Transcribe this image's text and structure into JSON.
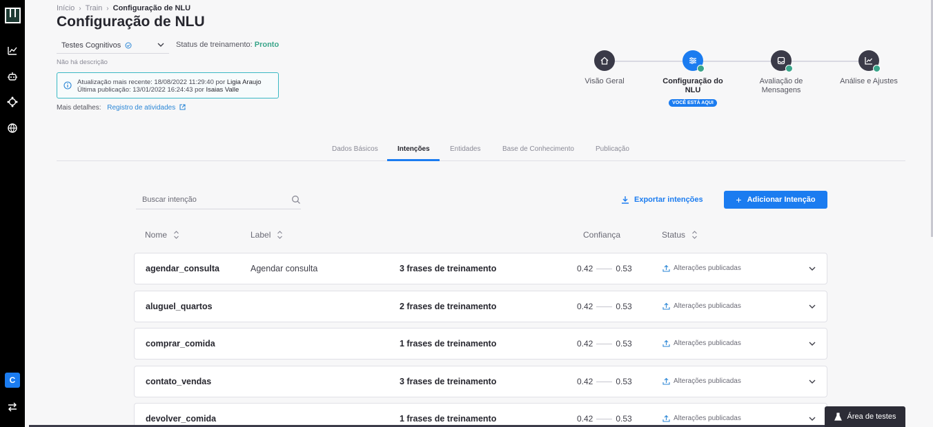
{
  "breadcrumb": {
    "home": "Início",
    "train": "Train",
    "current": "Configuração de NLU"
  },
  "page": {
    "title": "Configuração de NLU"
  },
  "bot_selector": {
    "value": "Testes Cognitivos"
  },
  "training_status": {
    "label": "Status de treinamento:",
    "value": "Pronto"
  },
  "description": "Não há descrição",
  "info": {
    "update_text": "Atualização mais recente: 18/08/2022 11:29:40 por ",
    "update_user": "Ligia Araujo",
    "publish_text": "Última publicação: 13/01/2022 16:24:43 por ",
    "publish_user": "Isaias Valle"
  },
  "more_details": {
    "label": "Mais detalhes:",
    "link": "Registro de atividades"
  },
  "stepper": {
    "steps": [
      {
        "label": "Visão Geral",
        "icon": "home-icon"
      },
      {
        "label": "Configuração do NLU",
        "icon": "sliders-icon",
        "badge": "VOCÊ ESTÁ AQUI"
      },
      {
        "label": "Avaliação de Mensagens",
        "icon": "inbox-icon"
      },
      {
        "label": "Análise e Ajustes",
        "icon": "chart-icon"
      }
    ]
  },
  "tabs": [
    "Dados Básicos",
    "Intenções",
    "Entidades",
    "Base de Conhecimento",
    "Publicação"
  ],
  "toolbar": {
    "search_placeholder": "Buscar intenção",
    "export_label": "Exportar intenções",
    "add_label": "Adicionar Intenção"
  },
  "table": {
    "headers": {
      "name": "Nome",
      "label": "Label",
      "confidence": "Confiança",
      "status": "Status"
    },
    "rows": [
      {
        "name": "agendar_consulta",
        "label": "Agendar consulta",
        "phrases": "3 frases de treinamento",
        "conf_min": "0.42",
        "conf_max": "0.53",
        "status": "Alterações publicadas"
      },
      {
        "name": "aluguel_quartos",
        "label": "",
        "phrases": "2 frases de treinamento",
        "conf_min": "0.42",
        "conf_max": "0.53",
        "status": "Alterações publicadas"
      },
      {
        "name": "comprar_comida",
        "label": "",
        "phrases": "1 frases de treinamento",
        "conf_min": "0.42",
        "conf_max": "0.53",
        "status": "Alterações publicadas"
      },
      {
        "name": "contato_vendas",
        "label": "",
        "phrases": "3 frases de treinamento",
        "conf_min": "0.42",
        "conf_max": "0.53",
        "status": "Alterações publicadas"
      },
      {
        "name": "devolver_comida",
        "label": "",
        "phrases": "1 frases de treinamento",
        "conf_min": "0.42",
        "conf_max": "0.53",
        "status": "Alterações publicadas"
      }
    ]
  },
  "test_area": {
    "label": "Área de testes"
  },
  "sidebar": {
    "workspace_letter": "C"
  },
  "colors": {
    "accent": "#1b7cf0",
    "success": "#3aa58a",
    "info_border": "#38b8c4",
    "sidebar": "#000000"
  }
}
